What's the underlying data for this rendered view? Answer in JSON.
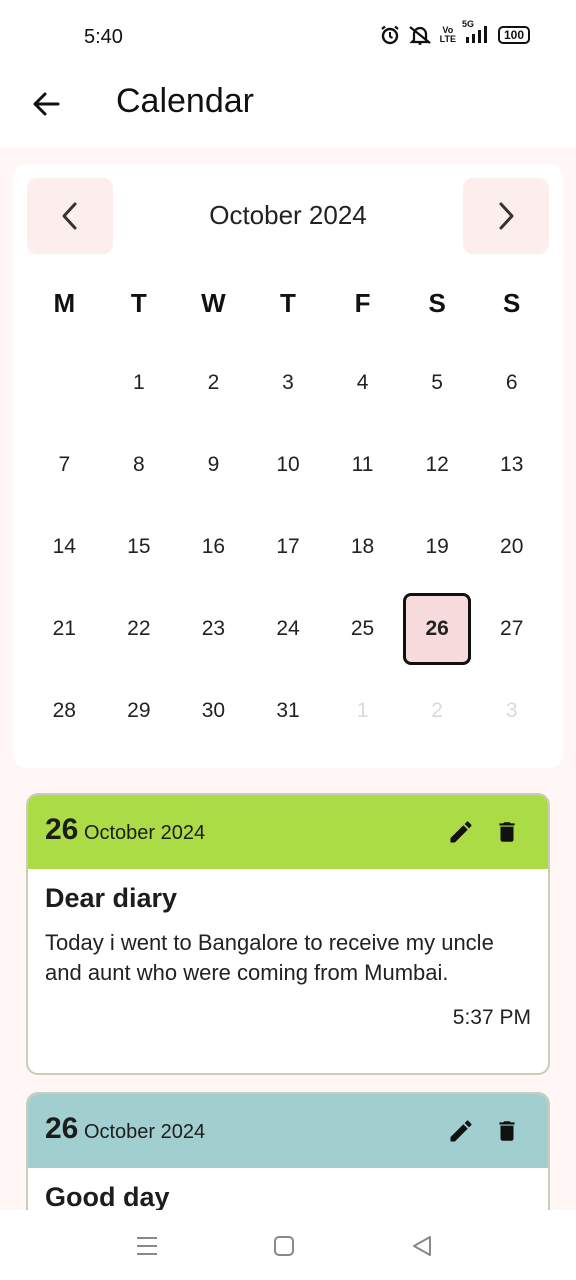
{
  "status_bar": {
    "time": "5:40",
    "battery": "100",
    "network_label": "5G",
    "volte_top": "Vo",
    "volte_bottom": "LTE"
  },
  "app_bar": {
    "title": "Calendar"
  },
  "calendar": {
    "month_label": "October 2024",
    "weekdays": [
      "M",
      "T",
      "W",
      "T",
      "F",
      "S",
      "S"
    ],
    "weeks": [
      [
        "",
        "1",
        "2",
        "3",
        "4",
        "5",
        "6"
      ],
      [
        "7",
        "8",
        "9",
        "10",
        "11",
        "12",
        "13"
      ],
      [
        "14",
        "15",
        "16",
        "17",
        "18",
        "19",
        "20"
      ],
      [
        "21",
        "22",
        "23",
        "24",
        "25",
        "26",
        "27"
      ],
      [
        "28",
        "29",
        "30",
        "31",
        "1",
        "2",
        "3"
      ]
    ],
    "selected_day": "26"
  },
  "entries": [
    {
      "day": "26",
      "month_year": "October 2024",
      "title": "Dear diary",
      "text": "Today i went to Bangalore to receive my uncle and aunt who were coming from Mumbai.",
      "time": "5:37 PM",
      "color": "#abdc46"
    },
    {
      "day": "26",
      "month_year": "October 2024",
      "title": "Good day",
      "text": "",
      "time": "",
      "color": "#a1cfd0"
    }
  ],
  "colors": {
    "accent_soft": "#fbeeed",
    "selected_fill": "#f7dadb",
    "background": "#fff6f5"
  },
  "icons": [
    "back-arrow-icon",
    "chevron-left-icon",
    "chevron-right-icon",
    "edit-icon",
    "delete-icon",
    "menu-icon",
    "home-icon",
    "back-triangle-icon",
    "alarm-icon",
    "mute-icon",
    "signal-icon",
    "battery-icon"
  ]
}
